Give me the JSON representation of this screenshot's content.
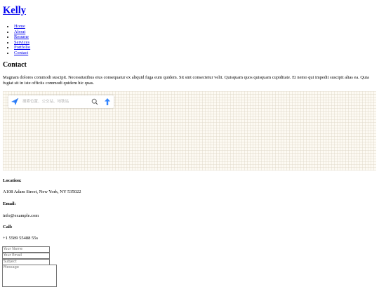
{
  "site": {
    "title": "Kelly"
  },
  "nav": {
    "items": [
      {
        "label": "Home"
      },
      {
        "label": "About"
      },
      {
        "label": "Resume"
      },
      {
        "label": "Services"
      },
      {
        "label": "Portfolio"
      },
      {
        "label": "Contact"
      }
    ]
  },
  "contact": {
    "heading": "Contact",
    "intro": "Magnam dolores commodi suscipit. Necessitatibus eius consequatur ex aliquid fuga eum quidem. Sit sint consectetur velit. Quisquam quos quisquam cupiditate. Et nemo qui impedit suscipit alias ea. Quia fugiat sit in iste officiis commodi quidem hic quas."
  },
  "map": {
    "search_placeholder": "搜索位置、公交站、地铁站",
    "logo_icon": "paper-plane-icon",
    "search_icon": "magnifier-icon",
    "route_icon": "route-arrow-icon",
    "colors": {
      "logo": "#3385ff",
      "route": "#3385ff",
      "background": "#fdfaf3"
    }
  },
  "info": {
    "location_title": "Location:",
    "location_value": "A108 Adam Street, New York, NY 535022",
    "email_title": "Email:",
    "email_value": "info@example.com",
    "call_title": "Call:",
    "call_value": "+1 5589 55488 55s"
  },
  "form": {
    "name_placeholder": "Your Name",
    "email_placeholder": "Your Email",
    "subject_placeholder": "Subject",
    "message_placeholder": "Message"
  }
}
